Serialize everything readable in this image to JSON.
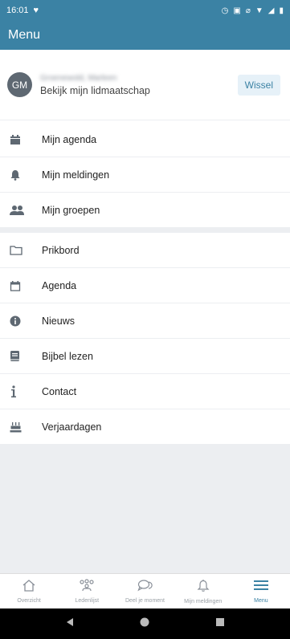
{
  "status_bar": {
    "time": "16:01",
    "icons": [
      "heart-icon",
      "alarm-icon",
      "nfc-icon",
      "mute-icon",
      "wifi-icon",
      "signal-icon",
      "battery-icon"
    ]
  },
  "app_bar": {
    "title": "Menu"
  },
  "profile": {
    "initials": "GM",
    "name": "Groenewold, Marleen",
    "subtitle": "Bekijk mijn lidmaatschap",
    "switch_label": "Wissel"
  },
  "personal_menu": [
    {
      "label": "Mijn agenda",
      "icon": "calendar-icon"
    },
    {
      "label": "Mijn meldingen",
      "icon": "bell-icon"
    },
    {
      "label": "Mijn groepen",
      "icon": "users-icon"
    }
  ],
  "main_menu": [
    {
      "label": "Prikbord",
      "icon": "folder-icon"
    },
    {
      "label": "Agenda",
      "icon": "calendar-outline-icon"
    },
    {
      "label": "Nieuws",
      "icon": "info-icon"
    },
    {
      "label": "Bijbel lezen",
      "icon": "book-icon"
    },
    {
      "label": "Contact",
      "icon": "info-i-icon"
    },
    {
      "label": "Verjaardagen",
      "icon": "cake-icon"
    }
  ],
  "bottom_nav": [
    {
      "label": "Overzicht",
      "icon": "home-icon",
      "active": false
    },
    {
      "label": "Ledenlijst",
      "icon": "members-icon",
      "active": false
    },
    {
      "label": "Deel je moment",
      "icon": "chat-icon",
      "active": false
    },
    {
      "label": "Mijn meldingen",
      "icon": "bell-outline-icon",
      "active": false
    },
    {
      "label": "Menu",
      "icon": "menu-icon",
      "active": true
    }
  ],
  "colors": {
    "primary": "#3b82a4",
    "background": "#eceef1"
  }
}
